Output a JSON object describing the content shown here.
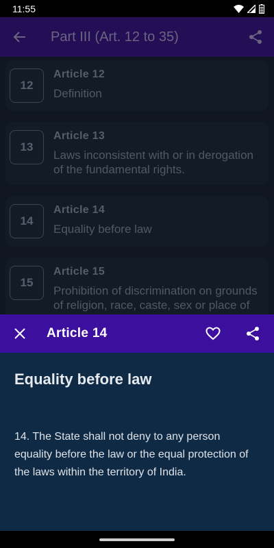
{
  "status_bar": {
    "time": "11:55"
  },
  "app_bar": {
    "title": "Part III (Art. 12 to 35)"
  },
  "articles": [
    {
      "number": "12",
      "title": "Article 12",
      "description": "Definition"
    },
    {
      "number": "13",
      "title": "Article 13",
      "description": "Laws inconsistent with or in derogation of the fundamental rights."
    },
    {
      "number": "14",
      "title": "Article 14",
      "description": "Equality before law"
    },
    {
      "number": "15",
      "title": "Article 15",
      "description": "Prohibition of discrimination on grounds of religion, race, caste, sex or place of birth"
    }
  ],
  "sheet": {
    "title": "Article 14",
    "heading": "Equality before law",
    "body": "14. The State shall not deny to any person equality before the law or the equal protection of the laws within the territory of India."
  },
  "colors": {
    "app_bar_dim": "#240f56",
    "sheet_bar": "#3c0f9f",
    "sheet_bg": "#0f2a45",
    "page_bg": "#0f1620"
  },
  "icons": {
    "back": "arrow-left-icon",
    "share": "share-icon",
    "close": "close-icon",
    "favorite": "heart-outline-icon"
  }
}
